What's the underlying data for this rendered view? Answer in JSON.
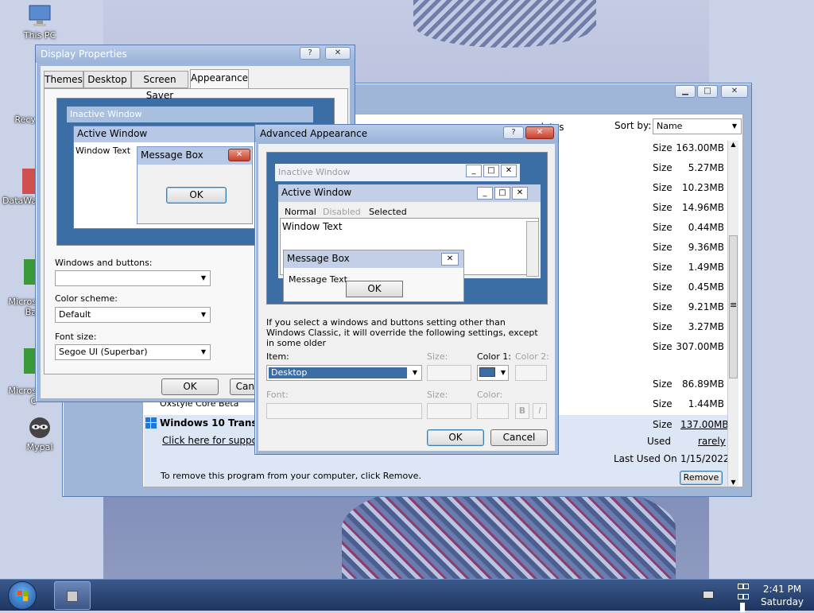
{
  "desktop": {
    "icons": [
      {
        "label": "This PC"
      },
      {
        "label": "Recy"
      },
      {
        "label": "DataWa"
      },
      {
        "label": "Micros\nBa"
      },
      {
        "label": "Micros\nC"
      },
      {
        "label": "Mypal"
      }
    ]
  },
  "programs_window": {
    "sort_label": "Sort by:",
    "sort_value": "Name",
    "updates_text": "updates",
    "size_label": "Size",
    "sizes": [
      "163.00MB",
      "5.27MB",
      "10.23MB",
      "14.96MB",
      "0.44MB",
      "9.36MB",
      "1.49MB",
      "0.45MB",
      "9.21MB",
      "3.27MB",
      "307.00MB",
      "86.89MB",
      "1.44MB"
    ],
    "program_item_partial": "Oxstyle Core Beta",
    "selected_program": "Windows 10 Transform",
    "support_link": "Click here for support",
    "selected_size": "137.00MB",
    "used_label": "Used",
    "used_value": "rarely",
    "last_used_label": "Last Used On",
    "last_used_value": "1/15/2022",
    "remove_hint": "To remove this program from your computer, click Remove.",
    "remove_button": "Remove"
  },
  "display_properties": {
    "title": "Display Properties",
    "tabs": [
      "Themes",
      "Desktop",
      "Screen Saver",
      "Appearance"
    ],
    "preview": {
      "inactive": "Inactive Window",
      "active": "Active Window",
      "window_text": "Window Text",
      "message_box": "Message Box",
      "ok": "OK"
    },
    "windows_buttons_label": "Windows and buttons:",
    "windows_buttons_value": "",
    "color_scheme_label": "Color scheme:",
    "color_scheme_value": "Default",
    "font_size_label": "Font size:",
    "font_size_value": "Segoe UI (Superbar)",
    "ok": "OK",
    "cancel": "Can"
  },
  "advanced": {
    "title": "Advanced Appearance",
    "preview": {
      "inactive": "Inactive Window",
      "active": "Active Window",
      "normal": "Normal",
      "disabled": "Disabled",
      "selected": "Selected",
      "window_text": "Window Text",
      "message_box": "Message Box",
      "message_text": "Message Text",
      "ok": "OK"
    },
    "note": "If you select a windows and buttons setting other than Windows Classic, it will override the following settings, except in some older",
    "item_label": "Item:",
    "item_value": "Desktop",
    "size_label": "Size:",
    "color1_label": "Color 1:",
    "color2_label": "Color 2:",
    "font_label": "Font:",
    "font_size_label": "Size:",
    "font_color_label": "Color:",
    "bold": "B",
    "italic": "I",
    "ok": "OK",
    "cancel": "Cancel",
    "color1_value": "#3a6ea5"
  },
  "taskbar": {
    "time": "2:41 PM",
    "day": "Saturday"
  }
}
